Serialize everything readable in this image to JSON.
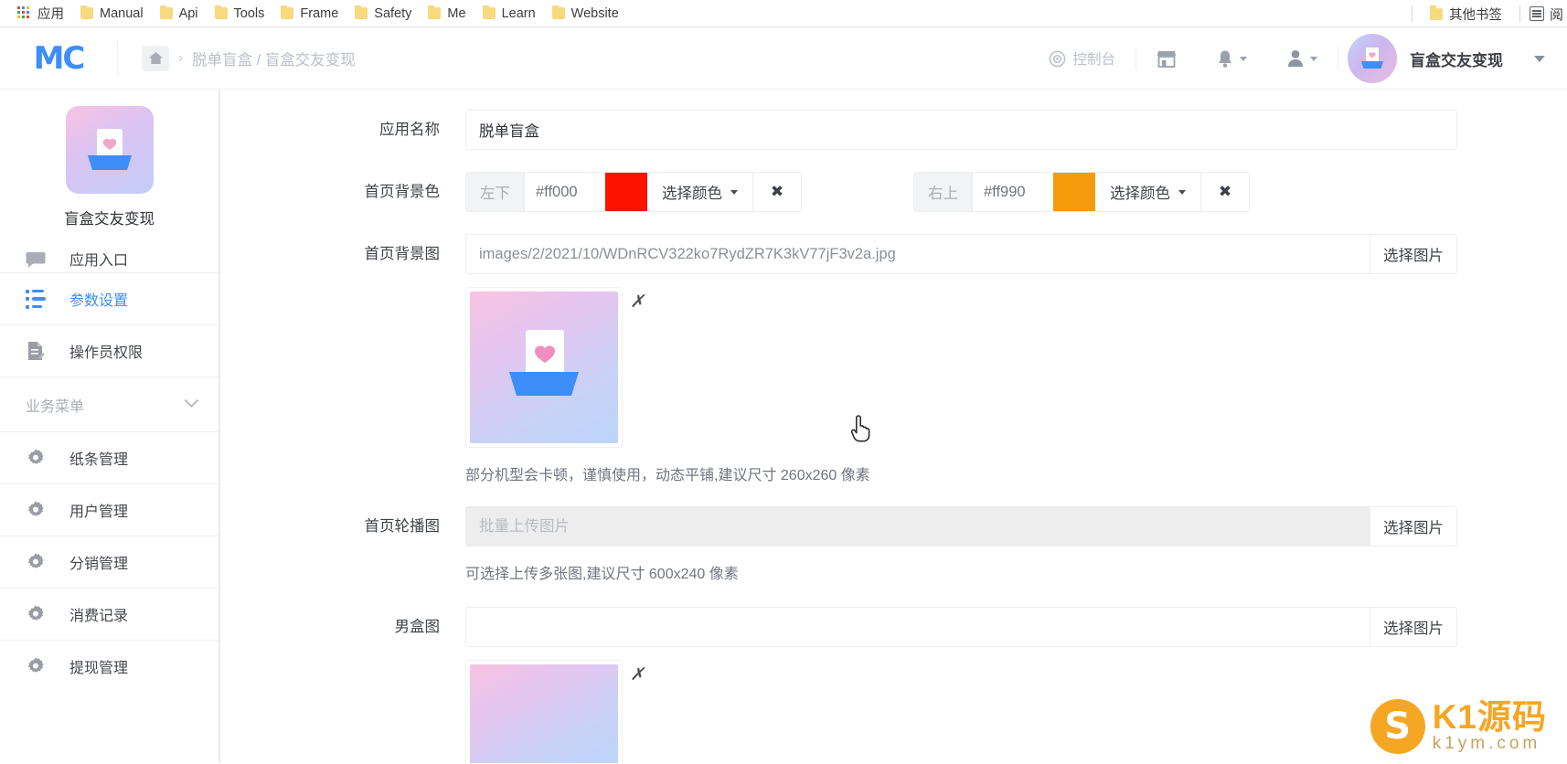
{
  "browser": {
    "apps_label": "应用",
    "bookmarks": [
      "Manual",
      "Api",
      "Tools",
      "Frame",
      "Safety",
      "Me",
      "Learn",
      "Website"
    ],
    "other_bookmarks": "其他书签",
    "reading_list": "阅"
  },
  "header": {
    "logo": "MC",
    "breadcrumb": "脱单盲盒 / 盲盒交友变现",
    "console": "控制台",
    "account_name": "盲盒交友变现"
  },
  "sidebar": {
    "app_name": "盲盒交友变现",
    "items": [
      {
        "label": "应用入口",
        "icon": "chat-icon",
        "active": false
      },
      {
        "label": "参数设置",
        "icon": "list-icon",
        "active": true
      },
      {
        "label": "操作员权限",
        "icon": "document-pen-icon",
        "active": false
      }
    ],
    "section_title": "业务菜单",
    "business_items": [
      {
        "label": "纸条管理",
        "icon": "gear-icon"
      },
      {
        "label": "用户管理",
        "icon": "gear-icon"
      },
      {
        "label": "分销管理",
        "icon": "gear-icon"
      },
      {
        "label": "消费记录",
        "icon": "gear-icon"
      },
      {
        "label": "提现管理",
        "icon": "gear-icon"
      }
    ]
  },
  "form": {
    "app_name": {
      "label": "应用名称",
      "value": "脱单盲盒"
    },
    "bg_color": {
      "label": "首页背景色",
      "groups": [
        {
          "position": "左下",
          "value": "#ff000",
          "swatch": "#fb1200",
          "pick_label": "选择颜色",
          "clear_label": "✖"
        },
        {
          "position": "右上",
          "value": "#ff990",
          "swatch": "#f59b0b",
          "pick_label": "选择颜色",
          "clear_label": "✖"
        }
      ]
    },
    "bg_image": {
      "label": "首页背景图",
      "value": "images/2/2021/10/WDnRCV322ko7RydZR7K3kV77jF3v2a.jpg",
      "button": "选择图片",
      "hint": "部分机型会卡顿，谨慎使用，动态平铺,建议尺寸 260x260 像素",
      "remove_label": "✗"
    },
    "carousel": {
      "label": "首页轮播图",
      "placeholder": "批量上传图片",
      "button": "选择图片",
      "hint": "可选择上传多张图,建议尺寸 600x240 像素"
    },
    "male_box": {
      "label": "男盒图",
      "value": "",
      "button": "选择图片"
    }
  },
  "watermark": {
    "letter": "S",
    "main": "K1源码",
    "sub": "k1ym.com"
  }
}
